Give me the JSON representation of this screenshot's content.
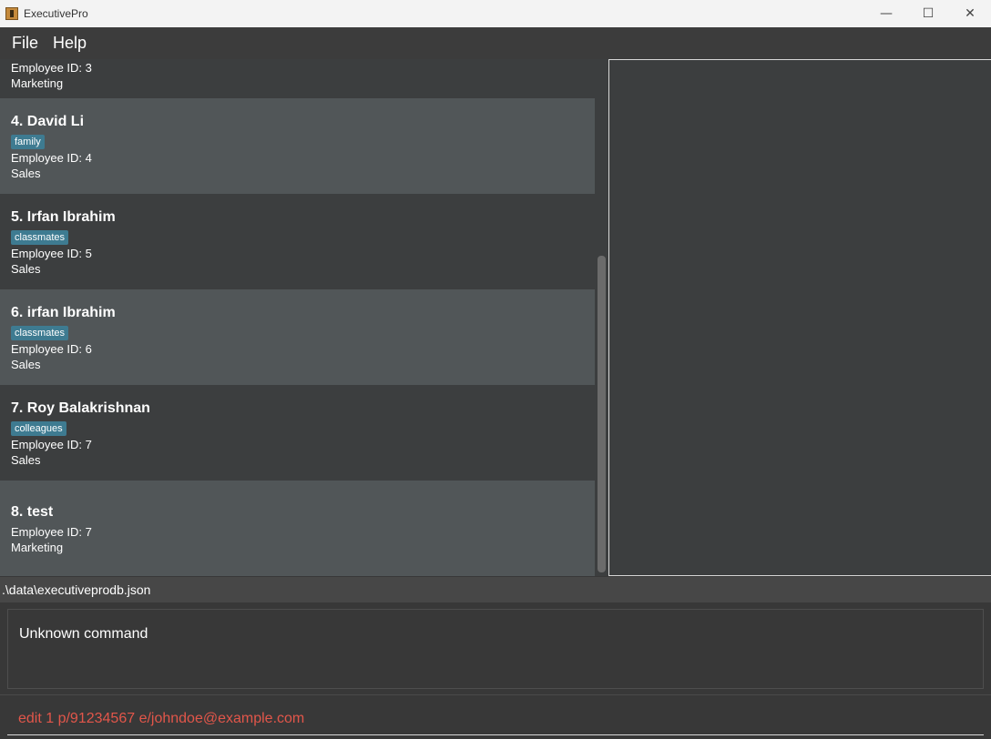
{
  "window": {
    "title": "ExecutivePro",
    "controls": {
      "minimize": "—",
      "maximize": "☐",
      "close": "✕"
    }
  },
  "menu": [
    {
      "label": "File"
    },
    {
      "label": "Help"
    }
  ],
  "partial_card": {
    "employee_id": "Employee ID: 3",
    "department": "Marketing"
  },
  "employees": [
    {
      "title": "4.  David Li",
      "tag": "family",
      "employee_id": "Employee ID: 4",
      "department": "Sales"
    },
    {
      "title": "5.  Irfan Ibrahim",
      "tag": "classmates",
      "employee_id": "Employee ID: 5",
      "department": "Sales"
    },
    {
      "title": "6.  irfan Ibrahim",
      "tag": "classmates",
      "employee_id": "Employee ID: 6",
      "department": "Sales"
    },
    {
      "title": "7.  Roy Balakrishnan",
      "tag": "colleagues",
      "employee_id": "Employee ID: 7",
      "department": "Sales"
    },
    {
      "title": "8.  test",
      "employee_id": "Employee ID: 7",
      "department": "Marketing"
    }
  ],
  "status": {
    "file_path": ".\\data\\executiveprodb.json"
  },
  "result": {
    "message": "Unknown command"
  },
  "command": {
    "value": "edit 1 p/91234567 e/johndoe@example.com"
  },
  "colors": {
    "tag_bg": "#3e7b91",
    "card_light": "#515658",
    "card_dark": "#3c3e3f",
    "command_text": "#e2564a"
  }
}
